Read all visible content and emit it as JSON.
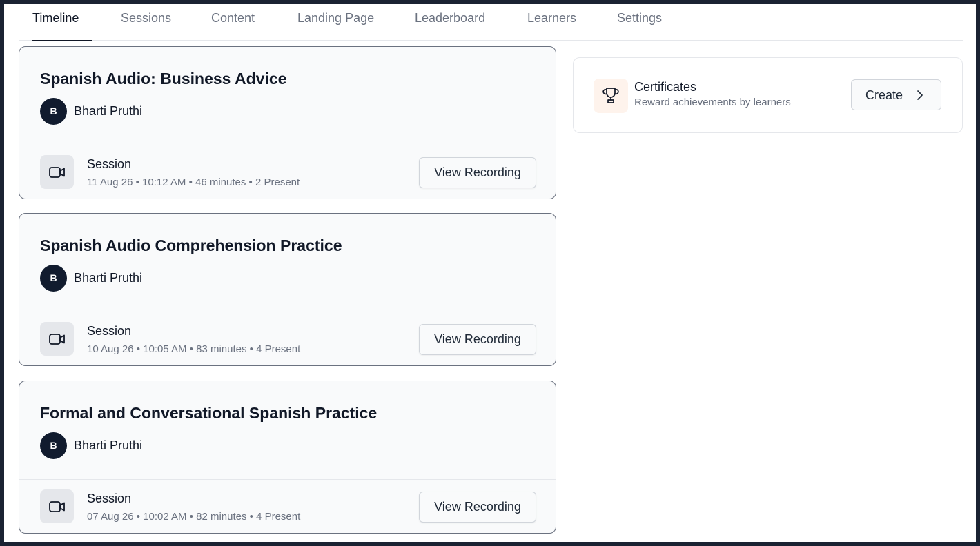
{
  "tabs": [
    {
      "label": "Timeline",
      "active": true
    },
    {
      "label": "Sessions"
    },
    {
      "label": "Content"
    },
    {
      "label": "Landing Page"
    },
    {
      "label": "Leaderboard"
    },
    {
      "label": "Learners"
    },
    {
      "label": "Settings"
    }
  ],
  "cards": [
    {
      "title": "Spanish Audio: Business Advice",
      "avatar_initial": "B",
      "author": "Bharti Pruthi",
      "session_label": "Session",
      "session_meta": "11 Aug 26 • 10:12 AM • 46 minutes • 2 Present",
      "button_label": "View Recording",
      "icon": "video-camera-icon"
    },
    {
      "title": "Spanish Audio Comprehension Practice",
      "avatar_initial": "B",
      "author": "Bharti Pruthi",
      "session_label": "Session",
      "session_meta": "10 Aug 26 • 10:05 AM • 83 minutes • 4 Present",
      "button_label": "View Recording",
      "icon": "video-camera-icon"
    },
    {
      "title": "Formal and Conversational Spanish Practice",
      "avatar_initial": "B",
      "author": "Bharti Pruthi",
      "session_label": "Session",
      "session_meta": "07 Aug 26 • 10:02 AM • 82 minutes • 4 Present",
      "button_label": "View Recording",
      "icon": "video-camera-icon"
    }
  ],
  "certificates": {
    "title": "Certificates",
    "subtitle": "Reward achievements by learners",
    "button_label": "Create",
    "icon": "trophy-icon",
    "button_icon": "chevron-right-icon"
  },
  "colors": {
    "text_primary": "#111827",
    "text_secondary": "#6b7280",
    "avatar_bg": "#111b2e",
    "trophy_bg": "#fef3ec"
  }
}
